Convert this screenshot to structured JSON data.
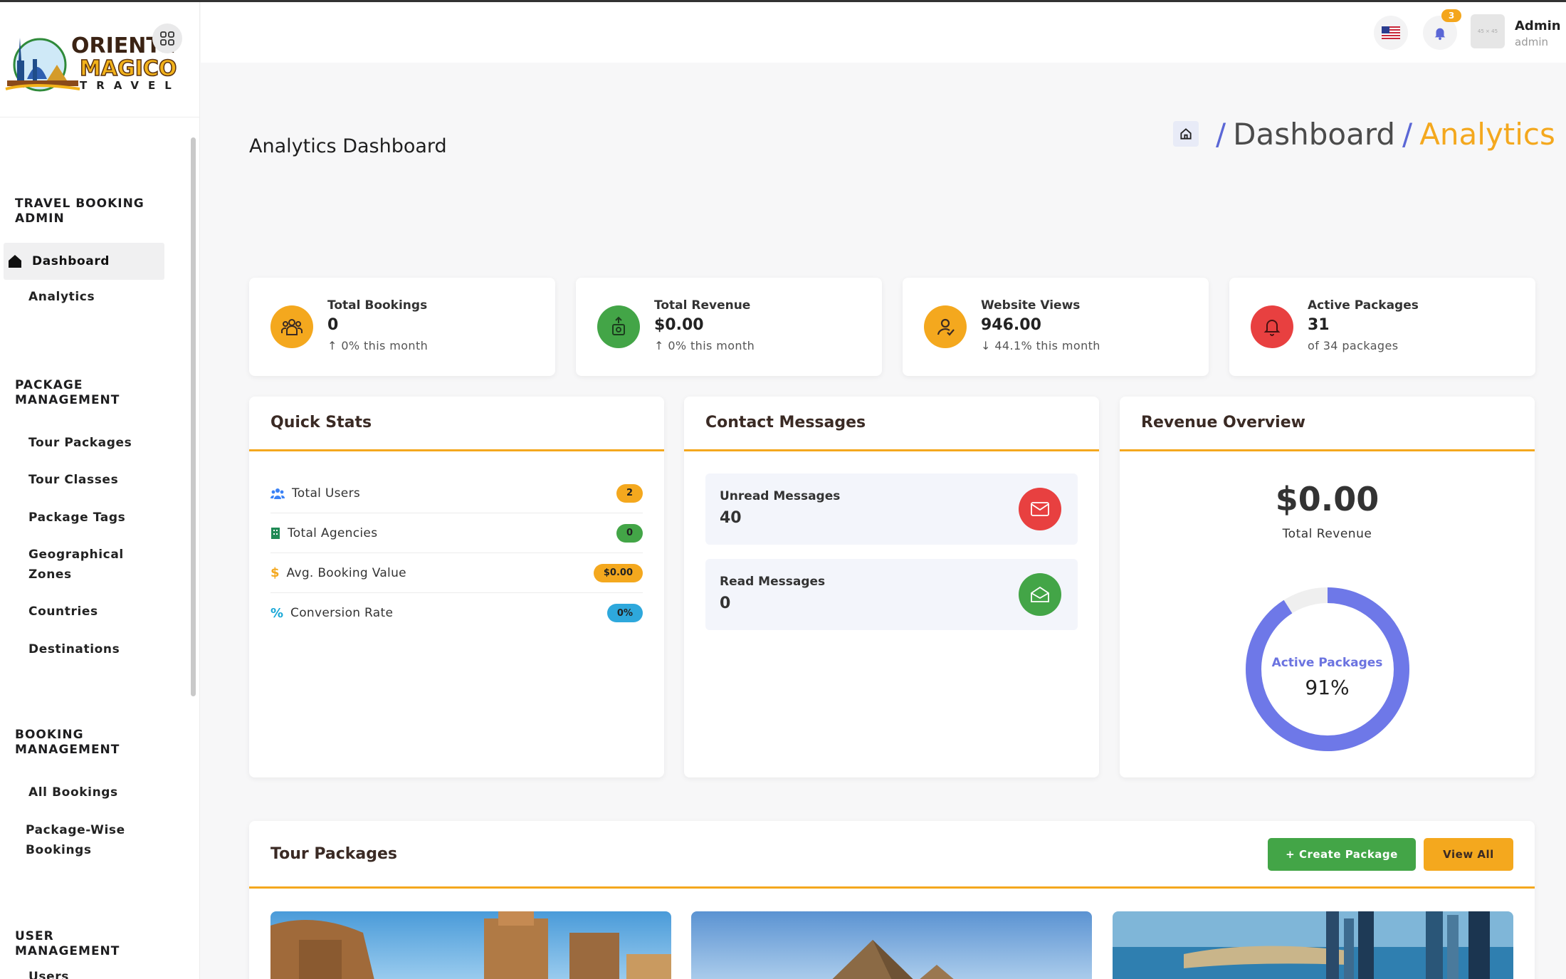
{
  "brand": {
    "line1": "ORIENTE",
    "line2": "MAGICO",
    "line3": "TRAVEL"
  },
  "sidebar": {
    "sections": [
      {
        "title": "TRAVEL BOOKING ADMIN"
      },
      {
        "title": "PACKAGE MANAGEMENT"
      },
      {
        "title": "BOOKING MANAGEMENT"
      },
      {
        "title": "USER MANAGEMENT"
      }
    ],
    "items": {
      "dashboard": "Dashboard",
      "analytics": "Analytics",
      "tour_packages": "Tour Packages",
      "tour_classes": "Tour Classes",
      "package_tags": "Package Tags",
      "geo_zones": "Geographical Zones",
      "countries": "Countries",
      "destinations": "Destinations",
      "all_bookings": "All Bookings",
      "package_wise": "Package-Wise Bookings",
      "users": "Users"
    }
  },
  "header": {
    "notifications": "3",
    "avatar_placeholder": "45 × 45",
    "user_name": "Admin",
    "user_role": "admin"
  },
  "page": {
    "title": "Analytics Dashboard",
    "breadcrumb": {
      "sep": "/",
      "parent": "Dashboard",
      "current": "Analytics"
    }
  },
  "stats": [
    {
      "label": "Total Bookings",
      "value": "0",
      "sub": "0% this month"
    },
    {
      "label": "Total Revenue",
      "value": "$0.00",
      "sub": "0% this month"
    },
    {
      "label": "Website Views",
      "value": "946.00",
      "sub": "44.1% this month"
    },
    {
      "label": "Active Packages",
      "value": "31",
      "sub": "of 34 packages"
    }
  ],
  "quick_stats": {
    "title": "Quick Stats",
    "rows": [
      {
        "label": "Total Users",
        "value": "2"
      },
      {
        "label": "Total Agencies",
        "value": "0"
      },
      {
        "label": "Avg. Booking Value",
        "value": "$0.00"
      },
      {
        "label": "Conversion Rate",
        "value": "0%"
      }
    ]
  },
  "contact": {
    "title": "Contact Messages",
    "unread_label": "Unread Messages",
    "unread_value": "40",
    "read_label": "Read Messages",
    "read_value": "0"
  },
  "revenue": {
    "title": "Revenue Overview",
    "value": "$0.00",
    "label": "Total Revenue",
    "donut_label": "Active Packages",
    "donut_value": "91%",
    "donut_fraction": 0.91
  },
  "tour_packages": {
    "title": "Tour Packages",
    "create_label": "+ Create Package",
    "view_all_label": "View All"
  },
  "colors": {
    "accent": "#f4a81e",
    "primary": "#5b67d6",
    "green": "#43a547",
    "red": "#e84040",
    "donut": "#6e78e8"
  }
}
